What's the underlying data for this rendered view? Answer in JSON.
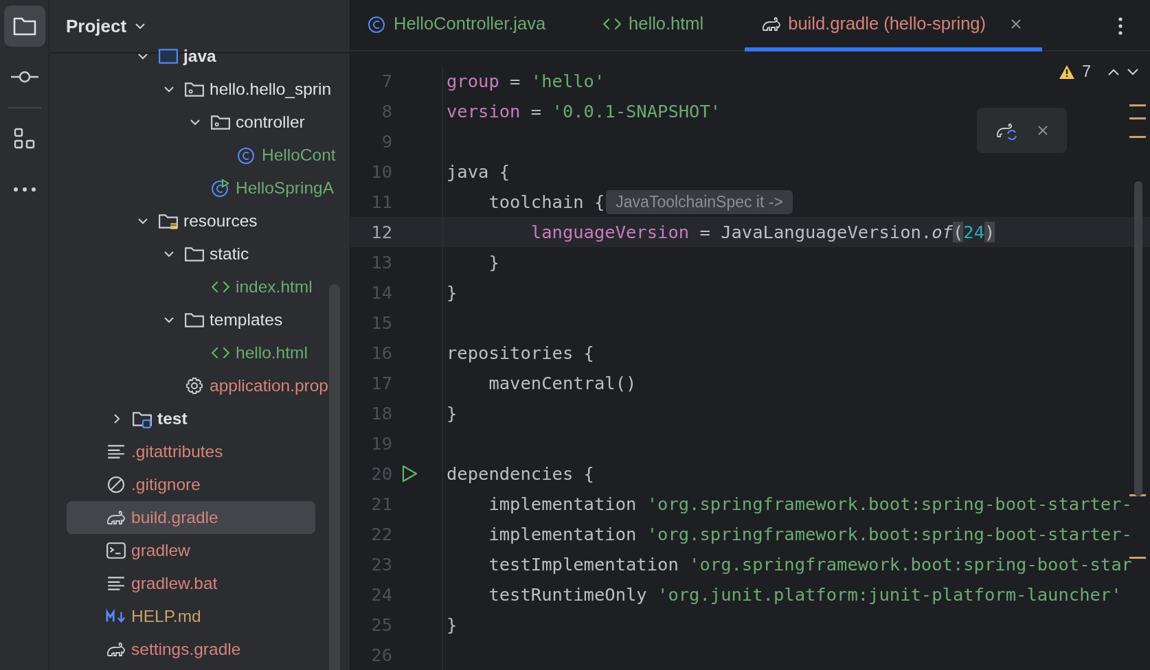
{
  "activity_bar": {
    "items": [
      {
        "kind": "folder",
        "selected": true
      },
      {
        "kind": "commit",
        "selected": false
      },
      {
        "kind": "structure",
        "selected": false
      },
      {
        "kind": "more",
        "selected": false
      }
    ]
  },
  "project_panel": {
    "title": "Project",
    "tree": [
      {
        "children": [
          {
            "children": [
              {
                "label": "java",
                "kind": "java-root",
                "expanded": true,
                "children": [
                  {
                    "label": "hello.hello_sprin",
                    "kind": "package",
                    "expanded": true,
                    "children": [
                      {
                        "label": "controller",
                        "kind": "package",
                        "expanded": true,
                        "children": [
                          {
                            "label": "HelloCont",
                            "kind": "class",
                            "color": "#6aab73",
                            "selected": false
                          }
                        ]
                      },
                      {
                        "label": "HelloSpringA",
                        "kind": "app-class",
                        "color": "#6aab73",
                        "selected": false
                      }
                    ]
                  }
                ]
              },
              {
                "label": "resources",
                "kind": "resources",
                "expanded": true,
                "children": [
                  {
                    "label": "static",
                    "kind": "folder",
                    "expanded": true,
                    "children": [
                      {
                        "label": "index.html",
                        "kind": "html",
                        "color": "#6aab73",
                        "selected": false
                      }
                    ]
                  },
                  {
                    "label": "templates",
                    "kind": "folder",
                    "expanded": true,
                    "children": [
                      {
                        "label": "hello.html",
                        "kind": "html",
                        "color": "#6aab73",
                        "selected": false
                      }
                    ]
                  },
                  {
                    "label": "application.prop",
                    "kind": "settings",
                    "color": "#d9837a",
                    "selected": false
                  }
                ]
              }
            ]
          },
          {
            "label": "test",
            "kind": "test-root",
            "expanded": false
          }
        ]
      },
      {
        "label": ".gitattributes",
        "kind": "text",
        "color": "#d9837a",
        "selected": false
      },
      {
        "label": ".gitignore",
        "kind": "ignore",
        "color": "#d9837a",
        "selected": false
      },
      {
        "label": "build.gradle",
        "kind": "gradle",
        "color": "#d9837a",
        "selected": true
      },
      {
        "label": "gradlew",
        "kind": "terminal",
        "color": "#d9837a",
        "selected": false
      },
      {
        "label": "gradlew.bat",
        "kind": "text",
        "color": "#d9837a",
        "selected": false
      },
      {
        "label": "HELP.md",
        "kind": "markdown",
        "color": "#c9a26d",
        "selected": false
      },
      {
        "label": "settings.gradle",
        "kind": "gradle",
        "color": "#d9837a",
        "selected": false
      }
    ]
  },
  "tabs": [
    {
      "label": "HelloController.java",
      "kind": "class",
      "color": "#6aab73",
      "selected": false
    },
    {
      "label": "hello.html",
      "kind": "html",
      "color": "#6aab73",
      "selected": false
    },
    {
      "label": "build.gradle (hello-spring)",
      "kind": "gradle",
      "color": "#d9837a",
      "selected": true
    }
  ],
  "editor": {
    "warnings": "7",
    "lines": [
      {
        "number": "7",
        "current": false,
        "run": false,
        "tokens": [
          {
            "t": "group",
            "kind": "prop"
          },
          {
            "t": " = ",
            "kind": "plain"
          },
          {
            "t": "'hello'",
            "kind": "string"
          }
        ]
      },
      {
        "number": "8",
        "current": false,
        "run": false,
        "tokens": [
          {
            "t": "version",
            "kind": "prop"
          },
          {
            "t": " = ",
            "kind": "plain"
          },
          {
            "t": "'0.0.1-SNAPSHOT'",
            "kind": "string"
          }
        ]
      },
      {
        "number": "9",
        "current": false,
        "run": false
      },
      {
        "number": "10",
        "current": false,
        "run": false,
        "tokens": [
          {
            "t": "java {",
            "kind": "plain"
          }
        ]
      },
      {
        "number": "11",
        "current": false,
        "run": false,
        "tokens": [
          {
            "t": "    toolchain {",
            "kind": "plain"
          },
          {
            "t": "JavaToolchainSpec it ->",
            "kind": "hint"
          }
        ]
      },
      {
        "number": "12",
        "current": true,
        "run": false,
        "tokens": [
          {
            "t": "        languageVersion",
            "kind": "prop"
          },
          {
            "t": " = JavaLanguageVersion.",
            "kind": "plain"
          },
          {
            "t": "of",
            "kind": "method"
          },
          {
            "t": "(",
            "kind": "brace"
          },
          {
            "t": "24",
            "kind": "number"
          },
          {
            "t": ")",
            "kind": "brace"
          }
        ]
      },
      {
        "number": "13",
        "current": false,
        "run": false,
        "tokens": [
          {
            "t": "    }",
            "kind": "plain"
          }
        ]
      },
      {
        "number": "14",
        "current": false,
        "run": false,
        "tokens": [
          {
            "t": "}",
            "kind": "plain"
          }
        ]
      },
      {
        "number": "15",
        "current": false,
        "run": false
      },
      {
        "number": "16",
        "current": false,
        "run": false,
        "tokens": [
          {
            "t": "repositories {",
            "kind": "plain"
          }
        ]
      },
      {
        "number": "17",
        "current": false,
        "run": false,
        "tokens": [
          {
            "t": "    mavenCentral()",
            "kind": "plain"
          }
        ]
      },
      {
        "number": "18",
        "current": false,
        "run": false,
        "tokens": [
          {
            "t": "}",
            "kind": "plain"
          }
        ]
      },
      {
        "number": "19",
        "current": false,
        "run": false
      },
      {
        "number": "20",
        "current": false,
        "run": true,
        "tokens": [
          {
            "t": "dependencies {",
            "kind": "plain"
          }
        ]
      },
      {
        "number": "21",
        "current": false,
        "run": false,
        "tokens": [
          {
            "t": "    implementation ",
            "kind": "plain"
          },
          {
            "t": "'org.springframework.boot:spring-boot-starter-",
            "kind": "string"
          }
        ]
      },
      {
        "number": "22",
        "current": false,
        "run": false,
        "tokens": [
          {
            "t": "    implementation ",
            "kind": "plain"
          },
          {
            "t": "'org.springframework.boot:spring-boot-starter-",
            "kind": "string"
          }
        ]
      },
      {
        "number": "23",
        "current": false,
        "run": false,
        "tokens": [
          {
            "t": "    testImplementation ",
            "kind": "plain"
          },
          {
            "t": "'org.springframework.boot:spring-boot-star",
            "kind": "string"
          }
        ]
      },
      {
        "number": "24",
        "current": false,
        "run": false,
        "tokens": [
          {
            "t": "    testRuntimeOnly ",
            "kind": "plain"
          },
          {
            "t": "'org.junit.platform:junit-platform-launcher'",
            "kind": "string"
          }
        ]
      },
      {
        "number": "25",
        "current": false,
        "run": false,
        "tokens": [
          {
            "t": "}",
            "kind": "plain"
          }
        ]
      },
      {
        "number": "26",
        "current": false,
        "run": false
      }
    ]
  }
}
